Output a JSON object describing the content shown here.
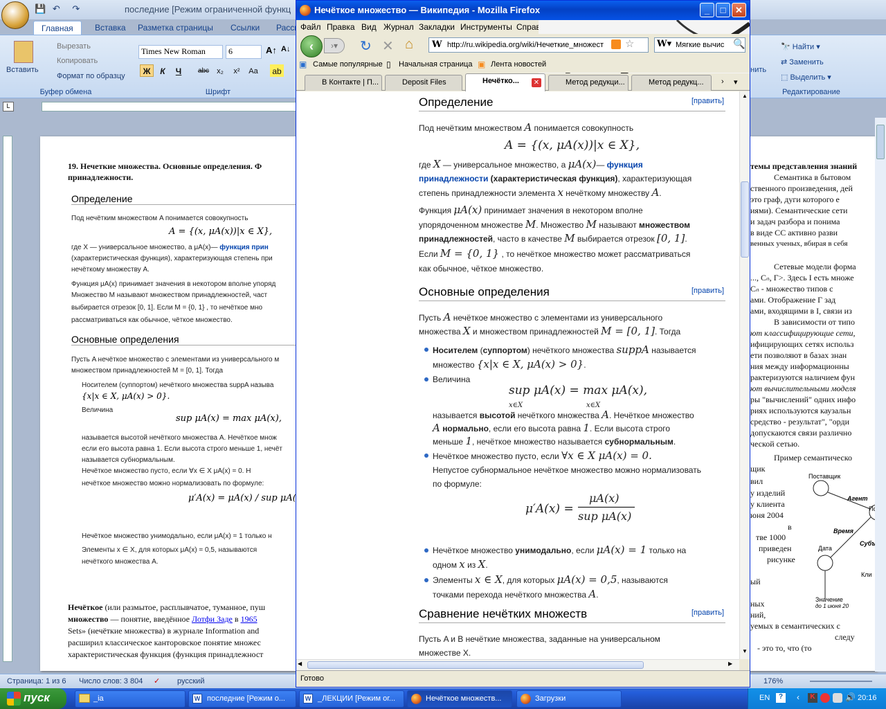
{
  "word": {
    "title": "последние [Режим ограниченной функц",
    "tabs": [
      "Главная",
      "Вставка",
      "Разметка страницы",
      "Ссылки",
      "Рассы"
    ],
    "clipboard": {
      "paste": "Вставить",
      "cut": "Вырезать",
      "copy": "Копировать",
      "format_painter": "Формат по образцу",
      "label": "Буфер обмена"
    },
    "font": {
      "name": "Times New Roman",
      "size": "6",
      "label": "Шрифт",
      "bold": "Ж",
      "italic": "К",
      "underline": "Ч",
      "strike": "abc",
      "sub": "x₂",
      "sup": "x²",
      "case": "Aa"
    },
    "editing": {
      "find": "Найти",
      "replace": "Заменить",
      "select": "Выделить",
      "label": "Редактирование",
      "styles_fragment": "енить"
    },
    "doc_left": {
      "heading": "19. Нечеткие множества. Основные определения. Ф",
      "heading2": "принадлежности.",
      "h_def": "Определение",
      "p1": "Под нечётким множеством A понимается совокупность",
      "f1": "A = {(x, μA(x))|x ∈ X},",
      "p2a": "где X — универсальное множество, а μA(x)— ",
      "p2link": "функция прин",
      "p2b": "(характеристическая функция), характеризующая степень при",
      "p2c": "нечёткому множеству A.",
      "p3": "Функция μA(x) принимает значения в некотором вполне упоряд",
      "p3b": "Множество M называют множеством принадлежностей, част",
      "p3c": "выбирается отрезок [0, 1]. Если M = {0, 1} , то нечёткое мно",
      "p3d": "рассматриваться как обычное, чёткое множество.",
      "h_basic": "Основные определения",
      "p4": "Пусть A нечёткое множество с элементами из универсального м",
      "p4b": "множеством принадлежностей M = [0, 1]. Тогда",
      "b1": "Носителем (суппортом) нечёткого множества suppA называ",
      "b1b": "{x|x ∈ X, μA(x) > 0}.",
      "b2": "Величина",
      "b2f": "sup μA(x) = max μA(x),",
      "b2b": "называется высотой нечёткого множества A. Нечёткое множ",
      "b2c": "если его высота равна 1. Если высота строго меньше 1, нечёт",
      "b2d": "называется субнормальным.",
      "b3": "Нечёткое множество пусто, если ∀x ∈ X μA(x) = 0. Н",
      "b3b": "нечёткое множество можно нормализовать по формуле:",
      "b3f": "μ′A(x) = μA(x) / sup μA(x)",
      "b4": "Нечёткое множество унимодально, если μA(x) = 1 только н",
      "b5": "Элементы x ∈ X, для которых μA(x) = 0,5, называются",
      "b5b": "нечёткого множества A.",
      "body1a": "Нечёткое",
      "body1b": " (или размытое, расплывчатое, туманное, пуш",
      "body2a": "множество",
      "body2b": " — понятие, введённое ",
      "body2link": "Лотфи Заде",
      "body2c": " в ",
      "body2year": "1965",
      "body3": "Sets» (нечёткие множества) в журнале Information and",
      "body4": "расширил классическое канторовское понятие множес",
      "body5": "характеристическая функция (функция принадлежност"
    },
    "doc_right": {
      "l1": "темы представления знаний",
      "l2": "Семантика в бытовом",
      "l3": "ственного произведения, дей",
      "l4": "это граф, дуги которого е",
      "l5": "иями). Семантические сети",
      "l6": "и задач разбора и понима",
      "l7": "в виде СС активно разви",
      "l8": "венных ученых, вбирая в себя",
      "l9": "Сетевые модели форма",
      "l10": "..., Cₙ, Г>. Здесь I есть множе",
      "l11": "Cₙ - множество типов с",
      "l12": "ами. Отображение Г зад",
      "l13": "ами, входящими в I, связи из",
      "l14": "В зависимости от типо",
      "l15": "ют классифицирующие сети,",
      "l16": "ифицирующих сетях использ",
      "l17": "ети позволяют в базах знан",
      "l18": "ния между информационны",
      "l19": "рактеризуются наличием фун",
      "l20": "ют вычислительными моделя",
      "l21": "ры \"вычислений\" одних инфо",
      "l22": "риях используются каузальн",
      "l23": "средство - результат\", \"орди",
      "l24": "допускаются связи различно",
      "l25": "ческой сетью.",
      "l26": "Пример семантическо",
      "l27": "щик",
      "l28": "вил",
      "l29": "у изделий",
      "l30": "у клиента",
      "l31": "юня 2004",
      "l32": "в",
      "l33": "тве 1000",
      "l34": "приведен",
      "l35": "рисунке",
      "l36": "ый",
      "l37": "ных",
      "l38": "ний,",
      "l39": "уемых в семантических с",
      "l40": "следу",
      "l41": "- это то, что (то",
      "diag_supplier": "Поставщик",
      "diag_agent": "Агент",
      "diag_post": "Пост",
      "diag_time": "Время",
      "diag_subj": "Субъ",
      "diag_date": "Дата",
      "diag_client": "Кли",
      "diag_value": "Значение",
      "diag_value2": "до 1 июня 20"
    },
    "status": {
      "page": "Страница: 1 из 6",
      "words": "Число слов: 3 804",
      "lang": "русский",
      "zoom": "176%"
    }
  },
  "firefox": {
    "title": "Нечёткое множество — Википедия - Mozilla Firefox",
    "menu": [
      "Файл",
      "Правка",
      "Вид",
      "Журнал",
      "Закладки",
      "Инструменты",
      "Справка"
    ],
    "url": "http://ru.wikipedia.org/wiki/Нечеткие_множест",
    "search_value": "Мягкие вычис",
    "bookmarks": [
      "Самые популярные",
      "Начальная страница",
      "Лента новостей"
    ],
    "tabs": [
      "В Контакте | П...",
      "Deposit Files",
      "Нечётко...",
      "Метод редукци...",
      "Метод редукц..."
    ],
    "status": "Готово"
  },
  "wiki": {
    "edit": "[править]",
    "h_def": "Определение",
    "d1a": "Под нечётким множеством ",
    "d1b": " понимается совокупность",
    "formula1": "A = {(x, μA(x))|x ∈ X},",
    "d2a": "где ",
    "d2b": " — универсальное множество, а ",
    "d2c": "— ",
    "d2link": "функция",
    "d2link2": "принадлежности",
    "d2d": " (характеристическая функция)",
    "d2e": ", характеризующая",
    "d2f": "степень принадлежности элемента ",
    "d2g": " нечёткому множеству ",
    "d3a": "Функция ",
    "d3b": " принимает значения в некотором вполне",
    "d3c": "упорядоченном множестве ",
    "d3d": ". Множество ",
    "d3e": " называют ",
    "d3f": "множеством",
    "d3g": "принадлежностей",
    "d3h": ", часто в качестве ",
    "d3i": " выбирается отрезок ",
    "d4a": "Если ",
    "d4b": " , то нечёткое множество может рассматриваться",
    "d4c": "как обычное, чёткое множество.",
    "h_basic": "Основные определения",
    "o1a": "Пусть ",
    "o1b": " нечёткое множество с элементами из универсального",
    "o1c": "множества ",
    "o1d": " и множеством принадлежностей ",
    "o1e": ". Тогда",
    "b1a": "Носителем",
    "b1b": " (",
    "b1c": "суппортом",
    "b1d": ") нечёткого множества ",
    "b1e": " называется",
    "b1f": "множество ",
    "b2a": "Величина",
    "b2f": "sup μA(x) = max μA(x),",
    "b2sub1": "x∈X",
    "b2sub2": "x∈X",
    "b2b": "называется ",
    "b2c": "высотой",
    "b2d": " нечёткого множества ",
    "b2e": ". Нечёткое множество",
    "b2g": "нормально",
    "b2h": ", если его высота равна ",
    "b2i": ". Если высота строго",
    "b2j": "меньше ",
    "b2k": ", нечёткое множество называется ",
    "b2l": "субнормальным",
    "b3a": "Нечёткое множество пусто, если ",
    "b3f": "∀x ∈ X μA(x) = 0.",
    "b3b": "Непустое субнормальное нечёткое множество можно нормализовать",
    "b3c": "по формуле:",
    "b3num": "μA(x)",
    "b3lhs": "μ′A(x) =",
    "b3den": "sup μA(x)",
    "b4a": "Нечёткое множество ",
    "b4b": "унимодально",
    "b4c": ", если ",
    "b4f": "μA(x) = 1",
    "b4d": " только на",
    "b4e": "одном ",
    "b4g": " из ",
    "b5a": "Элементы ",
    "b5f": "x ∈ X",
    "b5b": ", для которых ",
    "b5g": "μA(x) = 0,5",
    "b5c": ", называются",
    "b5d": "точками перехода нечёткого множества ",
    "h_cmp": "Сравнение нечётких множеств",
    "c1": "Пусть A и B нечёткие множества, заданные на универсальном",
    "c2": "множестве X.",
    "sym_A": "A",
    "sym_X": "X",
    "sym_x": "x",
    "sym_M": "M",
    "sym_mu": "μA(x)",
    "sym_01": "[0, 1]",
    "sym_M01": "M = {0, 1}",
    "sym_Meq": "M = [0, 1]",
    "sym_supp": "suppA",
    "sym_set": "{x|x ∈ X, μA(x) > 0}",
    "sym_1": "1",
    "dot_period": "."
  },
  "taskbar": {
    "start": "пуск",
    "buttons": [
      "_ia",
      "последние [Режим о...",
      "_ЛЕКЦИИ [Режим ог...",
      "Нечёткое множеств...",
      "Загрузки"
    ],
    "lang": "EN",
    "time": "20:16"
  }
}
